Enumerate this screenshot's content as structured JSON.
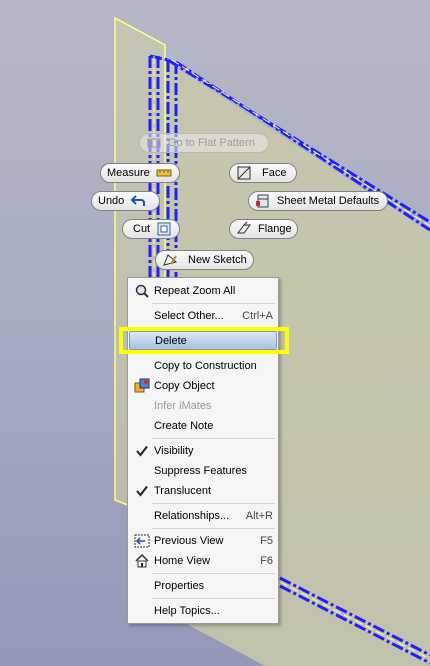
{
  "colors": {
    "highlight": "#ffff00",
    "geometry_edge": "#2020ff",
    "sketch_line": "#ffff80",
    "selection": "#a9c2e2"
  },
  "marking_menu": {
    "go_to_flat_pattern": {
      "label": "Go to Flat Pattern",
      "icon": "flat-pattern-icon",
      "enabled": false
    },
    "measure": {
      "label": "Measure",
      "icon": "ruler-icon"
    },
    "face": {
      "label": "Face",
      "icon": "face-icon"
    },
    "undo": {
      "label": "Undo",
      "icon": "undo-arrow-icon"
    },
    "sheet_metal_defaults": {
      "label": "Sheet Metal Defaults",
      "icon": "sheet-metal-defaults-icon"
    },
    "cut": {
      "label": "Cut",
      "icon": "cut-icon"
    },
    "flange": {
      "label": "Flange",
      "icon": "flange-icon"
    },
    "new_sketch": {
      "label": "New Sketch",
      "icon": "new-sketch-icon"
    }
  },
  "context_menu": {
    "items": [
      {
        "label": "Repeat Zoom All",
        "icon": "zoom-icon",
        "shortcut": ""
      },
      {
        "label": "Select Other...",
        "icon": "",
        "shortcut": "Ctrl+A"
      },
      {
        "label": "Delete",
        "icon": "",
        "shortcut": "",
        "selected": true
      },
      {
        "label": "Copy to Construction",
        "icon": "",
        "shortcut": ""
      },
      {
        "label": "Copy Object",
        "icon": "copy-object-icon",
        "shortcut": ""
      },
      {
        "label": "Infer iMates",
        "icon": "",
        "shortcut": "",
        "disabled": true
      },
      {
        "label": "Create Note",
        "icon": "",
        "shortcut": ""
      },
      {
        "label": "Visibility",
        "icon": "checkmark-icon",
        "shortcut": ""
      },
      {
        "label": "Suppress Features",
        "icon": "",
        "shortcut": ""
      },
      {
        "label": "Translucent",
        "icon": "checkmark-icon",
        "shortcut": ""
      },
      {
        "label": "Relationships...",
        "icon": "",
        "shortcut": "Alt+R"
      },
      {
        "label": "Previous View",
        "icon": "previous-view-icon",
        "shortcut": "F5"
      },
      {
        "label": "Home View",
        "icon": "home-icon",
        "shortcut": "F6"
      },
      {
        "label": "Properties",
        "icon": "",
        "shortcut": ""
      },
      {
        "label": "Help Topics...",
        "icon": "",
        "shortcut": ""
      }
    ]
  }
}
